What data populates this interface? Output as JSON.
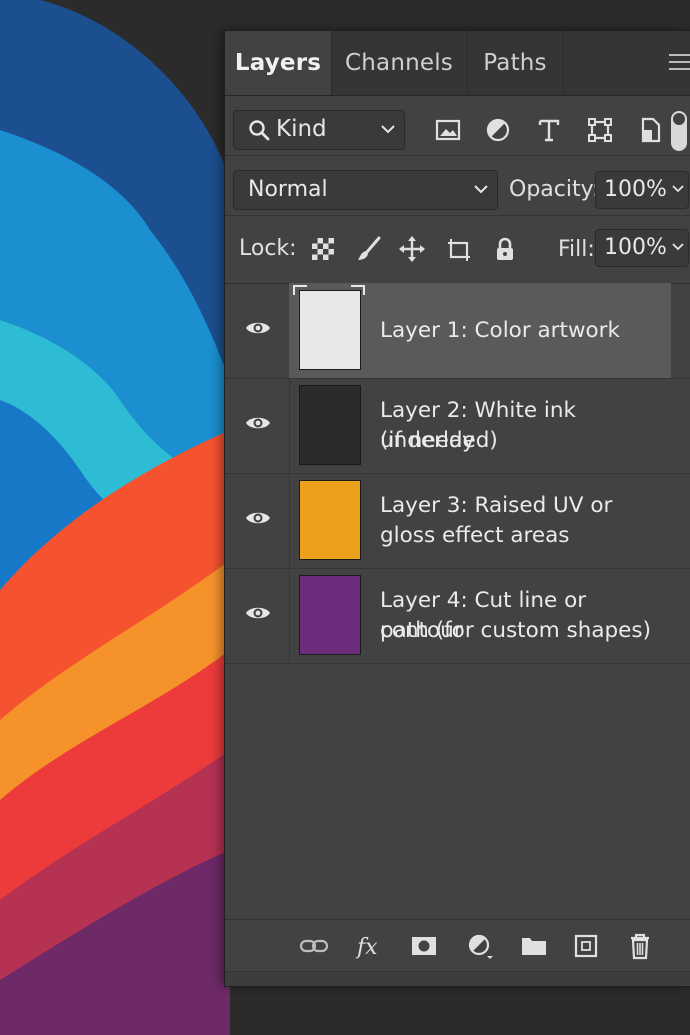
{
  "panel": {
    "tabs": [
      {
        "label": "Layers",
        "active": true
      },
      {
        "label": "Channels",
        "active": false
      },
      {
        "label": "Paths",
        "active": false
      }
    ],
    "menu_icon": "hamburger-menu-icon"
  },
  "filter": {
    "kind_label": "Kind",
    "icons": [
      "image-filter-icon",
      "adjustment-filter-icon",
      "type-filter-icon",
      "shape-filter-icon",
      "smart-object-filter-icon"
    ]
  },
  "blend": {
    "mode": "Normal",
    "opacity_label": "Opacity:",
    "opacity_value": "100%"
  },
  "lock": {
    "label": "Lock:",
    "icons": [
      "lock-transparent-pixels-icon",
      "lock-image-pixels-icon",
      "lock-position-icon",
      "lock-artboard-icon",
      "lock-all-icon"
    ],
    "fill_label": "Fill:",
    "fill_value": "100%"
  },
  "layers": [
    {
      "line1": "Layer 1: Color artwork",
      "line2": "",
      "thumb_color": "#e8e8e8",
      "selected": true
    },
    {
      "line1": "Layer 2: White ink underlay",
      "line2": "(if needed)",
      "thumb_color": "#2b2b2b",
      "selected": false
    },
    {
      "line1": "Layer 3: Raised UV or",
      "line2": "gloss effect areas",
      "thumb_color": "#eba11c",
      "selected": false
    },
    {
      "line1": "Layer 4: Cut line or contour",
      "line2": "path (for custom shapes)",
      "thumb_color": "#6b2d7c",
      "selected": false
    }
  ],
  "bottom_toolbar": [
    "link-layers-icon",
    "fx-icon",
    "add-mask-icon",
    "new-fill-adjustment-icon",
    "new-group-icon",
    "new-layer-icon",
    "delete-layer-icon"
  ],
  "colors": {
    "panel_bg": "#424242",
    "selected_row": "#5a5a5a",
    "canvas_bg": "#2b2b2b"
  }
}
